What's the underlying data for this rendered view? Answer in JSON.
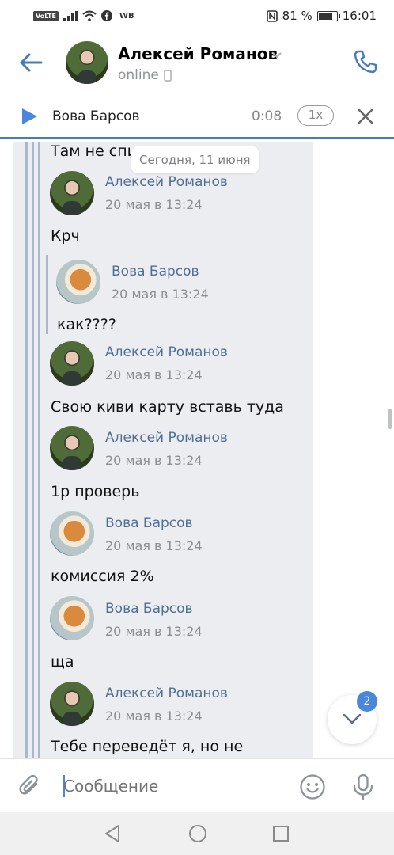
{
  "status_bar": {
    "left_icons": [
      "VoLTE",
      "signal-icon",
      "wifi-icon",
      "facebook-icon",
      "WB"
    ],
    "battery": "81 %",
    "battery_level": 0.81,
    "time": "16:01"
  },
  "header": {
    "contact_name": "Алексей Романов",
    "status": "online",
    "accent": "#4a7bb7"
  },
  "player": {
    "name": "Вова Барсов",
    "time": "0:08",
    "speed": "1x"
  },
  "chat": {
    "date_pill": "Сегодня, 11 июня",
    "top_fragment": "Там не спи",
    "messages": [
      {
        "author": "Алексей Романов",
        "date": "20 мая в 13:24",
        "text": "Крч"
      },
      {
        "author": "Вова Барсов",
        "date": "20 мая в 13:24",
        "text": "как????"
      },
      {
        "author": "Алексей Романов",
        "date": "20 мая в 13:24",
        "text": "Свою киви карту вставь туда"
      },
      {
        "author": "Алексей Романов",
        "date": "20 мая в 13:24",
        "text": "1р проверь"
      },
      {
        "author": "Вова Барсов",
        "date": "20 мая в 13:24",
        "text": "комиссия 2%"
      },
      {
        "author": "Вова Барсов",
        "date": "20 мая в 13:24",
        "text": "ща"
      },
      {
        "author": "Алексей Романов",
        "date": "20 мая в 13:24",
        "text": "Тебе переведёт я, но не"
      }
    ],
    "unread_badge": "2"
  },
  "compose": {
    "placeholder": "Сообщение"
  }
}
